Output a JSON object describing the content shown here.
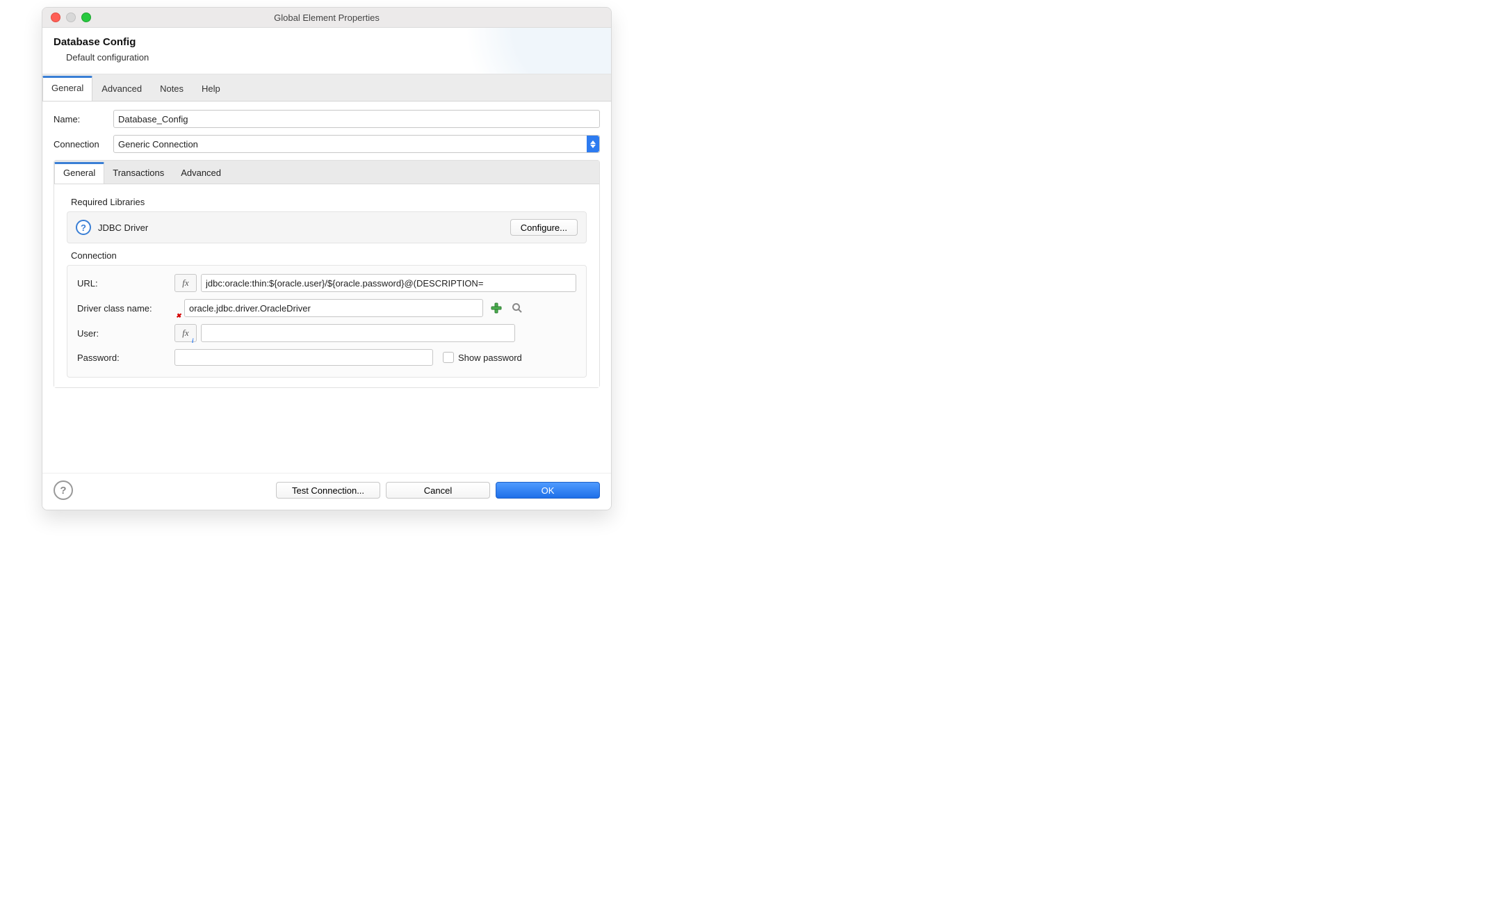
{
  "window": {
    "title": "Global Element Properties"
  },
  "header": {
    "title": "Database Config",
    "subtitle": "Default configuration"
  },
  "tabs": {
    "general": "General",
    "advanced": "Advanced",
    "notes": "Notes",
    "help": "Help"
  },
  "fields": {
    "name_label": "Name:",
    "name_value": "Database_Config",
    "connection_label": "Connection",
    "connection_value": "Generic Connection"
  },
  "subtabs": {
    "general": "General",
    "transactions": "Transactions",
    "advanced": "Advanced"
  },
  "libraries": {
    "section": "Required Libraries",
    "jdbc_label": "JDBC Driver",
    "configure_btn": "Configure..."
  },
  "connection": {
    "section": "Connection",
    "url_label": "URL:",
    "url_value": "jdbc:oracle:thin:${oracle.user}/${oracle.password}@(DESCRIPTION=",
    "driver_label": "Driver class name:",
    "driver_value": "oracle.jdbc.driver.OracleDriver",
    "user_label": "User:",
    "user_value": "",
    "password_label": "Password:",
    "password_value": "",
    "show_password_label": "Show password"
  },
  "footer": {
    "test": "Test Connection...",
    "cancel": "Cancel",
    "ok": "OK"
  },
  "fx_label": "fx"
}
